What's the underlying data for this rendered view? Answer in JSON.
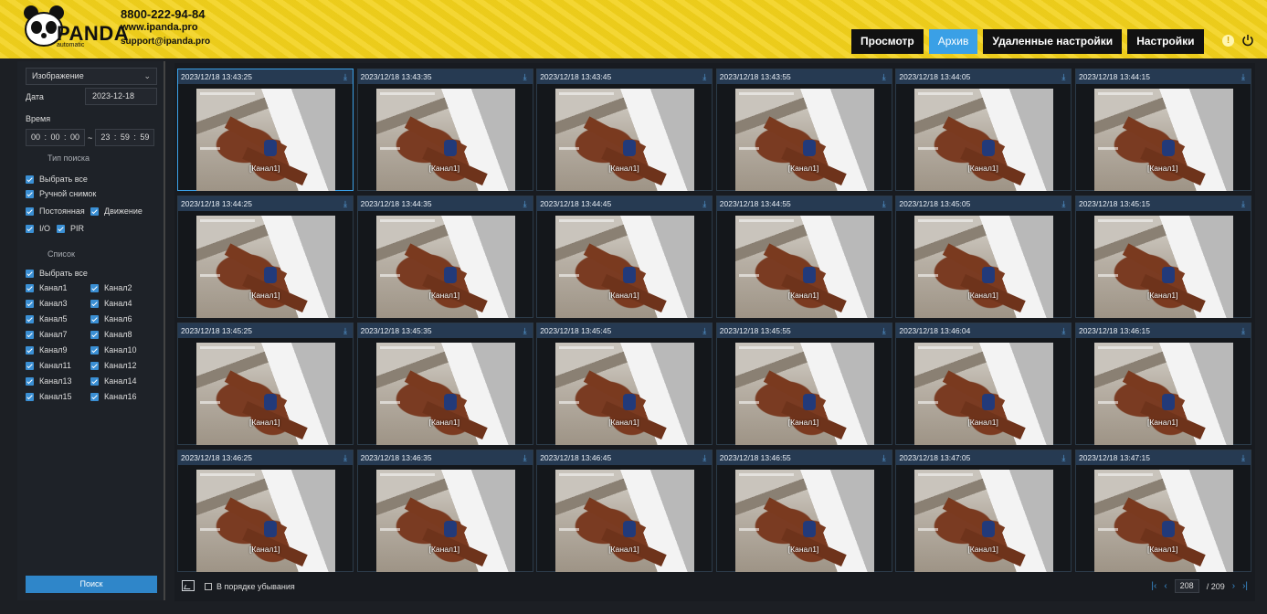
{
  "header": {
    "brand": "PANDA",
    "brand_sub": "automatic",
    "phone": "8800-222-94-84",
    "site": "www.ipanda.pro",
    "email": "support@ipanda.pro",
    "tabs": [
      {
        "label": "Просмотр",
        "active": false
      },
      {
        "label": "Архив",
        "active": true
      },
      {
        "label": "Удаленные настройки",
        "active": false
      },
      {
        "label": "Настройки",
        "active": false
      }
    ]
  },
  "sidebar": {
    "mode_select": "Изображение",
    "date_label": "Дата",
    "date_value": "2023-12-18",
    "time_label": "Время",
    "time_from": "00 : 00 : 00",
    "time_sep": "~",
    "time_to": "23 : 59 : 59",
    "search_type_title": "Тип поиска",
    "search_types": [
      {
        "label": "Выбрать все",
        "checked": true
      },
      {
        "label": "Ручной снимок",
        "checked": true
      },
      {
        "label": "Постоянная",
        "checked": true
      },
      {
        "label": "Движение",
        "checked": true
      },
      {
        "label": "I/O",
        "checked": true
      },
      {
        "label": "PIR",
        "checked": true
      }
    ],
    "list_title": "Список",
    "select_all": "Выбрать все",
    "channels": [
      "Канал1",
      "Канал2",
      "Канал3",
      "Канал4",
      "Канал5",
      "Канал6",
      "Канал7",
      "Канал8",
      "Канал9",
      "Канал10",
      "Канал11",
      "Канал12",
      "Канал13",
      "Канал14",
      "Канал15",
      "Канал16"
    ],
    "search_button": "Поиск"
  },
  "grid": {
    "channel_label": "[Канал1]",
    "items": [
      "2023/12/18 13:43:25",
      "2023/12/18 13:43:35",
      "2023/12/18 13:43:45",
      "2023/12/18 13:43:55",
      "2023/12/18 13:44:05",
      "2023/12/18 13:44:15",
      "2023/12/18 13:44:25",
      "2023/12/18 13:44:35",
      "2023/12/18 13:44:45",
      "2023/12/18 13:44:55",
      "2023/12/18 13:45:05",
      "2023/12/18 13:45:15",
      "2023/12/18 13:45:25",
      "2023/12/18 13:45:35",
      "2023/12/18 13:45:45",
      "2023/12/18 13:45:55",
      "2023/12/18 13:46:04",
      "2023/12/18 13:46:15",
      "2023/12/18 13:46:25",
      "2023/12/18 13:46:35",
      "2023/12/18 13:46:45",
      "2023/12/18 13:46:55",
      "2023/12/18 13:47:05",
      "2023/12/18 13:47:15"
    ],
    "selected_index": 0
  },
  "footer": {
    "sort_label": "В порядке убывания",
    "current_page": "208",
    "total_pages": "/ 209"
  },
  "colors": {
    "accent": "#3aa0e6",
    "header_bg": "#f3d21c"
  }
}
